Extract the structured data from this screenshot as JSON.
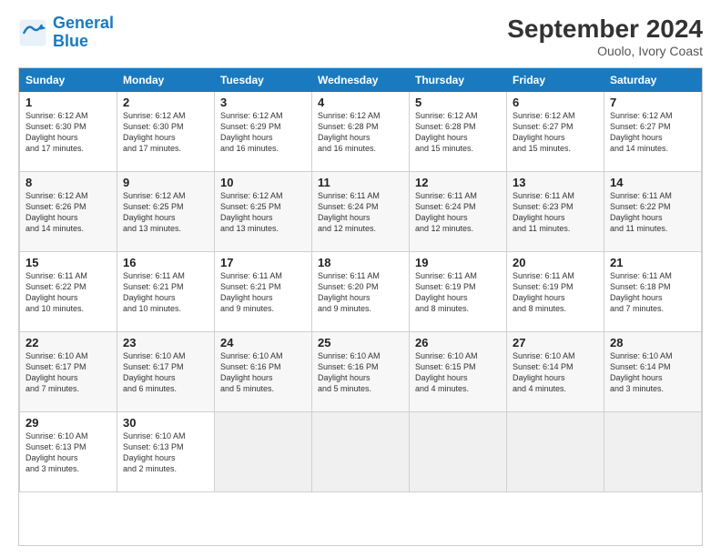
{
  "logo": {
    "line1": "General",
    "line2": "Blue"
  },
  "title": "September 2024",
  "subtitle": "Ouolo, Ivory Coast",
  "weekdays": [
    "Sunday",
    "Monday",
    "Tuesday",
    "Wednesday",
    "Thursday",
    "Friday",
    "Saturday"
  ],
  "weeks": [
    [
      {
        "day": "1",
        "sunrise": "6:12 AM",
        "sunset": "6:30 PM",
        "daylight": "12 hours and 17 minutes."
      },
      {
        "day": "2",
        "sunrise": "6:12 AM",
        "sunset": "6:30 PM",
        "daylight": "12 hours and 17 minutes."
      },
      {
        "day": "3",
        "sunrise": "6:12 AM",
        "sunset": "6:29 PM",
        "daylight": "12 hours and 16 minutes."
      },
      {
        "day": "4",
        "sunrise": "6:12 AM",
        "sunset": "6:28 PM",
        "daylight": "12 hours and 16 minutes."
      },
      {
        "day": "5",
        "sunrise": "6:12 AM",
        "sunset": "6:28 PM",
        "daylight": "12 hours and 15 minutes."
      },
      {
        "day": "6",
        "sunrise": "6:12 AM",
        "sunset": "6:27 PM",
        "daylight": "12 hours and 15 minutes."
      },
      {
        "day": "7",
        "sunrise": "6:12 AM",
        "sunset": "6:27 PM",
        "daylight": "12 hours and 14 minutes."
      }
    ],
    [
      {
        "day": "8",
        "sunrise": "6:12 AM",
        "sunset": "6:26 PM",
        "daylight": "12 hours and 14 minutes."
      },
      {
        "day": "9",
        "sunrise": "6:12 AM",
        "sunset": "6:25 PM",
        "daylight": "12 hours and 13 minutes."
      },
      {
        "day": "10",
        "sunrise": "6:12 AM",
        "sunset": "6:25 PM",
        "daylight": "12 hours and 13 minutes."
      },
      {
        "day": "11",
        "sunrise": "6:11 AM",
        "sunset": "6:24 PM",
        "daylight": "12 hours and 12 minutes."
      },
      {
        "day": "12",
        "sunrise": "6:11 AM",
        "sunset": "6:24 PM",
        "daylight": "12 hours and 12 minutes."
      },
      {
        "day": "13",
        "sunrise": "6:11 AM",
        "sunset": "6:23 PM",
        "daylight": "12 hours and 11 minutes."
      },
      {
        "day": "14",
        "sunrise": "6:11 AM",
        "sunset": "6:22 PM",
        "daylight": "12 hours and 11 minutes."
      }
    ],
    [
      {
        "day": "15",
        "sunrise": "6:11 AM",
        "sunset": "6:22 PM",
        "daylight": "12 hours and 10 minutes."
      },
      {
        "day": "16",
        "sunrise": "6:11 AM",
        "sunset": "6:21 PM",
        "daylight": "12 hours and 10 minutes."
      },
      {
        "day": "17",
        "sunrise": "6:11 AM",
        "sunset": "6:21 PM",
        "daylight": "12 hours and 9 minutes."
      },
      {
        "day": "18",
        "sunrise": "6:11 AM",
        "sunset": "6:20 PM",
        "daylight": "12 hours and 9 minutes."
      },
      {
        "day": "19",
        "sunrise": "6:11 AM",
        "sunset": "6:19 PM",
        "daylight": "12 hours and 8 minutes."
      },
      {
        "day": "20",
        "sunrise": "6:11 AM",
        "sunset": "6:19 PM",
        "daylight": "12 hours and 8 minutes."
      },
      {
        "day": "21",
        "sunrise": "6:11 AM",
        "sunset": "6:18 PM",
        "daylight": "12 hours and 7 minutes."
      }
    ],
    [
      {
        "day": "22",
        "sunrise": "6:10 AM",
        "sunset": "6:17 PM",
        "daylight": "12 hours and 7 minutes."
      },
      {
        "day": "23",
        "sunrise": "6:10 AM",
        "sunset": "6:17 PM",
        "daylight": "12 hours and 6 minutes."
      },
      {
        "day": "24",
        "sunrise": "6:10 AM",
        "sunset": "6:16 PM",
        "daylight": "12 hours and 5 minutes."
      },
      {
        "day": "25",
        "sunrise": "6:10 AM",
        "sunset": "6:16 PM",
        "daylight": "12 hours and 5 minutes."
      },
      {
        "day": "26",
        "sunrise": "6:10 AM",
        "sunset": "6:15 PM",
        "daylight": "12 hours and 4 minutes."
      },
      {
        "day": "27",
        "sunrise": "6:10 AM",
        "sunset": "6:14 PM",
        "daylight": "12 hours and 4 minutes."
      },
      {
        "day": "28",
        "sunrise": "6:10 AM",
        "sunset": "6:14 PM",
        "daylight": "12 hours and 3 minutes."
      }
    ],
    [
      {
        "day": "29",
        "sunrise": "6:10 AM",
        "sunset": "6:13 PM",
        "daylight": "12 hours and 3 minutes."
      },
      {
        "day": "30",
        "sunrise": "6:10 AM",
        "sunset": "6:13 PM",
        "daylight": "12 hours and 2 minutes."
      },
      null,
      null,
      null,
      null,
      null
    ]
  ]
}
